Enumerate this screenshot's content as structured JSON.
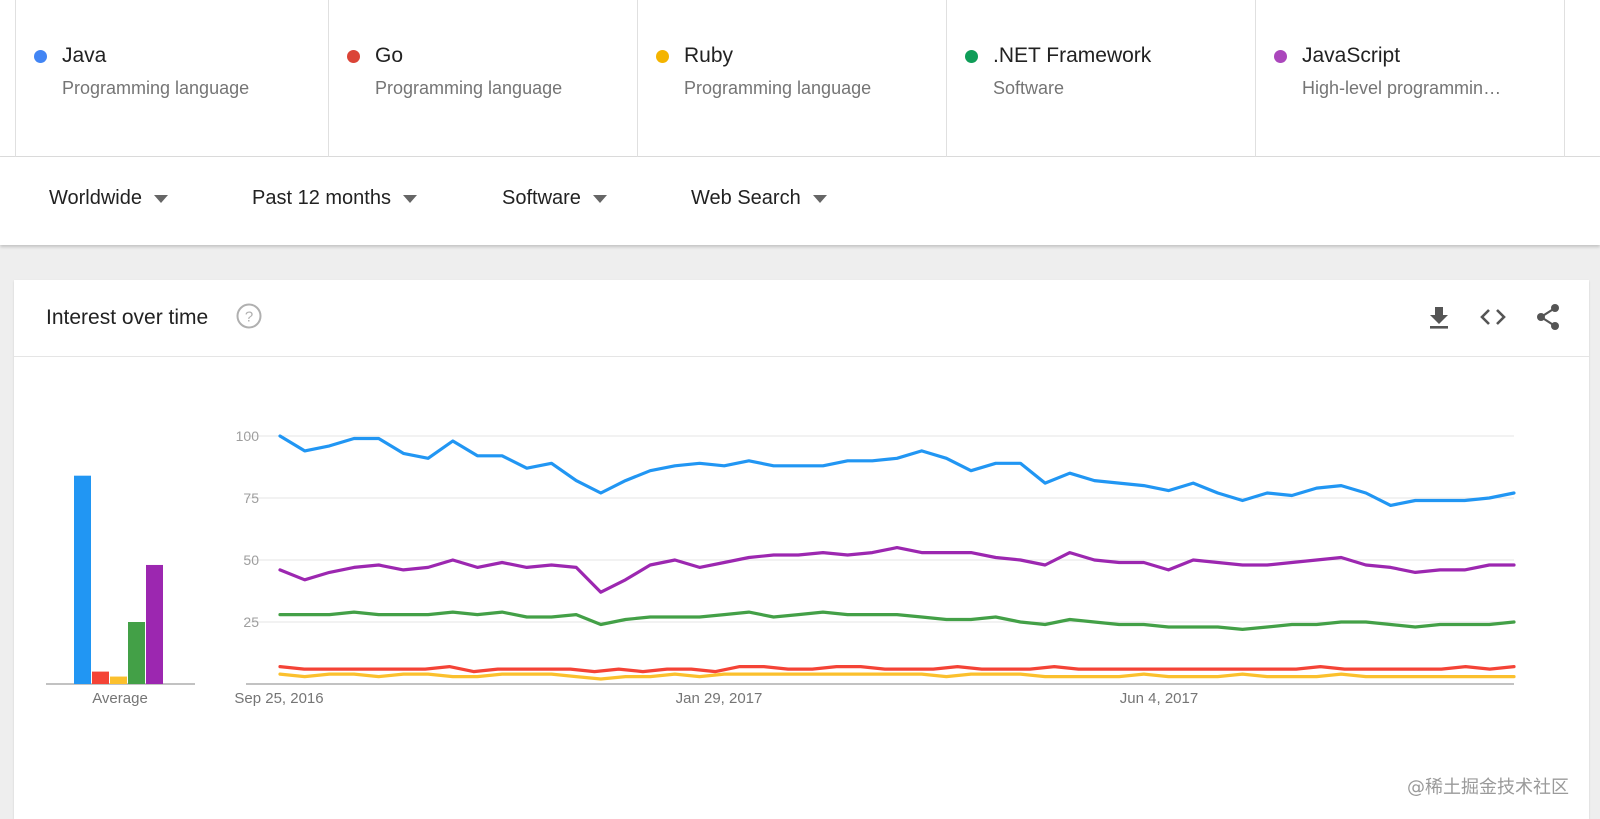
{
  "terms": [
    {
      "name": "Java",
      "subtitle": "Programming language",
      "color": "#4285f4"
    },
    {
      "name": "Go",
      "subtitle": "Programming language",
      "color": "#db4437"
    },
    {
      "name": "Ruby",
      "subtitle": "Programming language",
      "color": "#f4b400"
    },
    {
      "name": ".NET Framework",
      "subtitle": "Software",
      "color": "#0f9d58"
    },
    {
      "name": "JavaScript",
      "subtitle": "High-level programmin…",
      "color": "#ab47bc"
    }
  ],
  "filters": {
    "region": "Worldwide",
    "time": "Past 12 months",
    "category": "Software",
    "search_type": "Web Search"
  },
  "card": {
    "title": "Interest over time",
    "icons": [
      "help-icon",
      "download-icon",
      "embed-code-icon",
      "share-icon"
    ]
  },
  "watermark": "@稀土掘金技术社区",
  "chart_data": [
    {
      "type": "bar",
      "categories": [
        "Java",
        "Go",
        "Ruby",
        ".NET Framework",
        "JavaScript"
      ],
      "values": [
        84,
        5,
        3,
        25,
        48
      ],
      "colors": [
        "#2196f3",
        "#f44336",
        "#fbc02d",
        "#43a047",
        "#9c27b0"
      ],
      "xlabel": "Average",
      "ylim": [
        0,
        100
      ]
    },
    {
      "type": "line",
      "x_tick_labels": [
        "Sep 25, 2016",
        "Jan 29, 2017",
        "Jun 4, 2017"
      ],
      "y_ticks": [
        100,
        75,
        50,
        25
      ],
      "ylim": [
        0,
        100
      ],
      "grid": true,
      "series": [
        {
          "color": "#2196f3",
          "values": [
            100,
            94,
            96,
            99,
            99,
            93,
            91,
            98,
            92,
            92,
            87,
            89,
            82,
            77,
            82,
            86,
            88,
            89,
            88,
            90,
            88,
            88,
            88,
            90,
            90,
            91,
            94,
            91,
            86,
            89,
            89,
            81,
            85,
            82,
            81,
            80,
            78,
            81,
            77,
            74,
            77,
            76,
            79,
            80,
            77,
            72,
            74,
            74,
            74,
            75,
            77
          ]
        },
        {
          "color": "#9c27b0",
          "values": [
            46,
            42,
            45,
            47,
            48,
            46,
            47,
            50,
            47,
            49,
            47,
            48,
            47,
            37,
            42,
            48,
            50,
            47,
            49,
            51,
            52,
            52,
            53,
            52,
            53,
            55,
            53,
            53,
            53,
            51,
            50,
            48,
            53,
            50,
            49,
            49,
            46,
            50,
            49,
            48,
            48,
            49,
            50,
            51,
            48,
            47,
            45,
            46,
            46,
            48,
            48
          ]
        },
        {
          "color": "#43a047",
          "values": [
            28,
            28,
            28,
            29,
            28,
            28,
            28,
            29,
            28,
            29,
            27,
            27,
            28,
            24,
            26,
            27,
            27,
            27,
            28,
            29,
            27,
            28,
            29,
            28,
            28,
            28,
            27,
            26,
            26,
            27,
            25,
            24,
            26,
            25,
            24,
            24,
            23,
            23,
            23,
            22,
            23,
            24,
            24,
            25,
            25,
            24,
            23,
            24,
            24,
            24,
            25
          ]
        },
        {
          "color": "#f44336",
          "values": [
            7,
            6,
            6,
            6,
            6,
            6,
            6,
            7,
            5,
            6,
            6,
            6,
            6,
            5,
            6,
            5,
            6,
            6,
            5,
            7,
            7,
            6,
            6,
            7,
            7,
            6,
            6,
            6,
            7,
            6,
            6,
            6,
            7,
            6,
            6,
            6,
            6,
            6,
            6,
            6,
            6,
            6,
            6,
            7,
            6,
            6,
            6,
            6,
            6,
            7,
            6,
            7
          ]
        },
        {
          "color": "#fbc02d",
          "values": [
            4,
            3,
            4,
            4,
            3,
            4,
            4,
            3,
            3,
            4,
            4,
            4,
            3,
            2,
            3,
            3,
            4,
            3,
            4,
            4,
            4,
            4,
            4,
            4,
            4,
            4,
            4,
            3,
            4,
            4,
            4,
            3,
            3,
            3,
            3,
            4,
            3,
            3,
            3,
            4,
            3,
            3,
            3,
            4,
            3,
            3,
            3,
            3,
            3,
            3,
            3
          ]
        }
      ]
    }
  ]
}
